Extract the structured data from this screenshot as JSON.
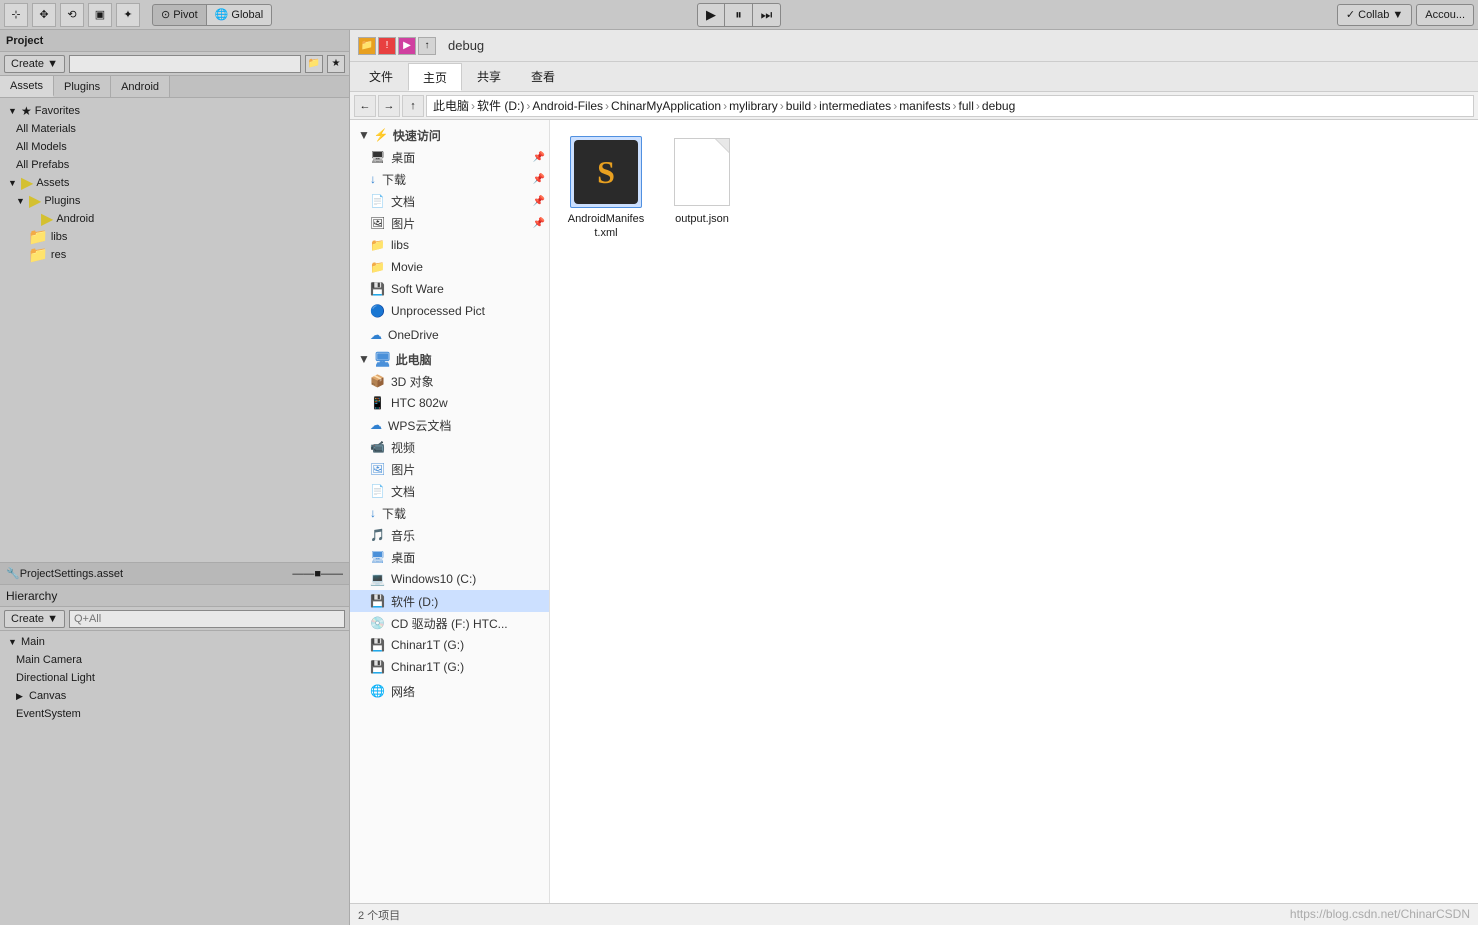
{
  "topbar": {
    "pivot_label": "Pivot",
    "global_label": "Global",
    "play_icon": "▶",
    "pause_icon": "⏸",
    "step_icon": "⏭",
    "collab_label": "Collab ▼",
    "account_label": "Accou..."
  },
  "project_panel": {
    "title": "Project",
    "create_label": "Create ▼",
    "search_placeholder": "",
    "tabs": [
      "Assets",
      "Plugins",
      "Android"
    ],
    "favorites": {
      "label": "Favorites",
      "items": [
        "All Materials",
        "All Models",
        "All Prefabs"
      ]
    },
    "assets": {
      "label": "Assets",
      "children": {
        "plugins": {
          "label": "Plugins",
          "children": {
            "android": {
              "label": "Android"
            }
          }
        }
      }
    },
    "footer_file": "ProjectSettings.asset"
  },
  "hierarchy_panel": {
    "title": "Hierarchy",
    "create_label": "Create ▼",
    "search_placeholder": "Q+All",
    "main_scene": {
      "label": "Main",
      "items": [
        "Main Camera",
        "Directional Light",
        "Canvas",
        "EventSystem"
      ]
    }
  },
  "file_explorer": {
    "title": "debug",
    "ribbon_tabs": [
      "文件",
      "主页",
      "共享",
      "查看"
    ],
    "active_tab": "主页",
    "address_path": [
      "此电脑",
      "软件 (D:)",
      "Android-Files",
      "ChinarMyApplication",
      "mylibrary",
      "build",
      "intermediates",
      "manifests",
      "full",
      "debug"
    ],
    "sidebar": {
      "quick_access": {
        "label": "快速访问",
        "items": [
          {
            "label": "桌面",
            "pinned": true
          },
          {
            "label": "下载",
            "pinned": true
          },
          {
            "label": "文档",
            "pinned": true
          },
          {
            "label": "图片",
            "pinned": true
          },
          {
            "label": "libs"
          },
          {
            "label": "Movie"
          },
          {
            "label": "Soft Ware"
          },
          {
            "label": "Unprocessed  Pict"
          }
        ]
      },
      "onedrive": {
        "label": "OneDrive"
      },
      "this_pc": {
        "label": "此电脑",
        "items": [
          {
            "label": "3D 对象"
          },
          {
            "label": "HTC 802w"
          },
          {
            "label": "WPS云文档"
          },
          {
            "label": "视频"
          },
          {
            "label": "图片"
          },
          {
            "label": "文档"
          },
          {
            "label": "下载"
          },
          {
            "label": "音乐"
          },
          {
            "label": "桌面"
          }
        ]
      },
      "drives": [
        {
          "label": "Windows10 (C:)"
        },
        {
          "label": "软件 (D:)",
          "selected": true
        },
        {
          "label": "CD 驱动器 (F:) HTC..."
        },
        {
          "label": "Chinar1T (G:)"
        },
        {
          "label": "Chinar1T (G:)"
        }
      ],
      "network": {
        "label": "网络"
      }
    },
    "files": [
      {
        "name": "AndroidManifest.xml",
        "type": "android"
      },
      {
        "name": "output.json",
        "type": "blank"
      }
    ]
  },
  "watermark": "https://blog.csdn.net/ChinаrCSDN"
}
